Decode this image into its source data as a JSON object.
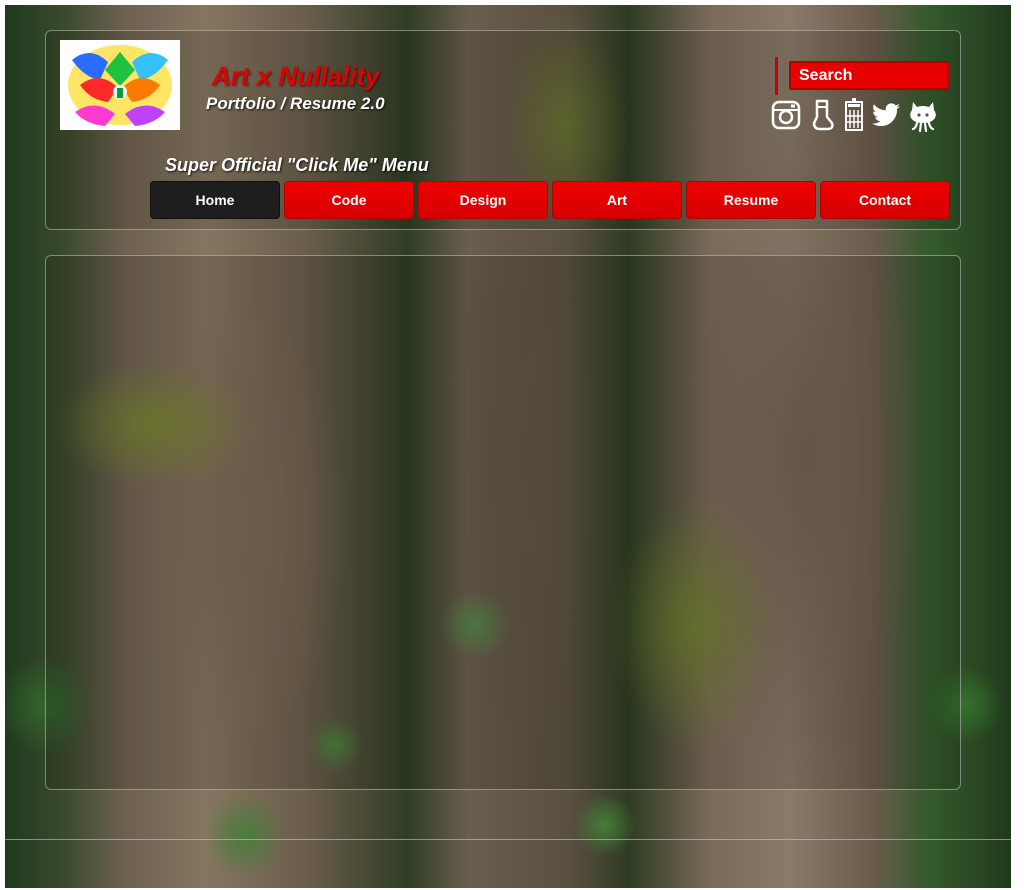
{
  "header": {
    "title": "Art x Nullality",
    "subtitle": "Portfolio / Resume 2.0"
  },
  "search": {
    "placeholder": "Search"
  },
  "social": [
    {
      "icon": "instagram-icon"
    },
    {
      "icon": "sock-icon"
    },
    {
      "icon": "phone-booth-icon"
    },
    {
      "icon": "twitter-icon"
    },
    {
      "icon": "github-octocat-icon"
    }
  ],
  "menu": {
    "title": "Super Official \"Click Me\" Menu",
    "items": [
      {
        "label": "Home",
        "active": true
      },
      {
        "label": "Code",
        "active": false
      },
      {
        "label": "Design",
        "active": false
      },
      {
        "label": "Art",
        "active": false
      },
      {
        "label": "Resume",
        "active": false
      },
      {
        "label": "Contact",
        "active": false
      }
    ]
  },
  "colors": {
    "accent": "#e60000",
    "active_nav": "#1e1e1e",
    "text": "#ffffff"
  }
}
